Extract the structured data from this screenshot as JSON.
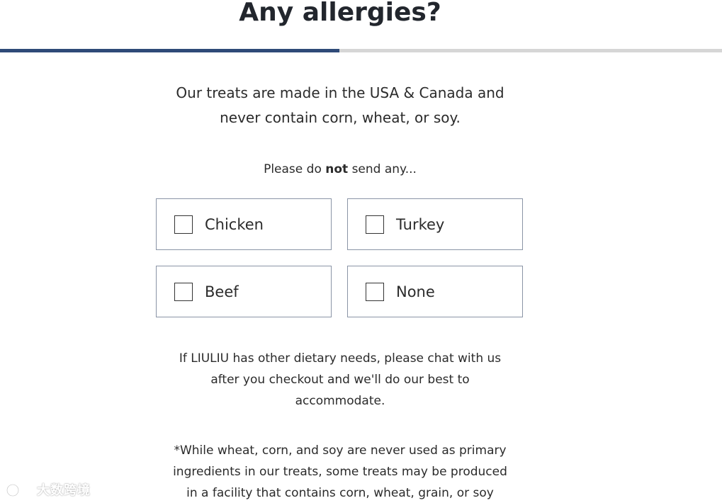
{
  "header": {
    "title": "Any allergies?"
  },
  "progress": {
    "fraction": 0.47,
    "fill_color": "#2f4a78",
    "track_color": "#d6d6d6"
  },
  "intro": {
    "line1": "Our treats are made in the USA & Canada and",
    "line2": "never contain corn, wheat, or soy."
  },
  "prompt": {
    "before": "Please do ",
    "emphasis": "not",
    "after": " send any..."
  },
  "options": [
    {
      "label": "Chicken",
      "checked": false
    },
    {
      "label": "Turkey",
      "checked": false
    },
    {
      "label": "Beef",
      "checked": false
    },
    {
      "label": "None",
      "checked": false
    }
  ],
  "note": {
    "line1": "If LIULIU has other dietary needs, please chat with us",
    "line2": "after you checkout and we'll do our best to",
    "line3": "accommodate."
  },
  "footnote": {
    "line1": "*While wheat, corn, and soy are never used as primary",
    "line2": "ingredients in our treats, some treats may be produced",
    "line3": "in a facility that contains corn, wheat, grain, or soy"
  },
  "watermark": {
    "text": "大数跨境"
  }
}
